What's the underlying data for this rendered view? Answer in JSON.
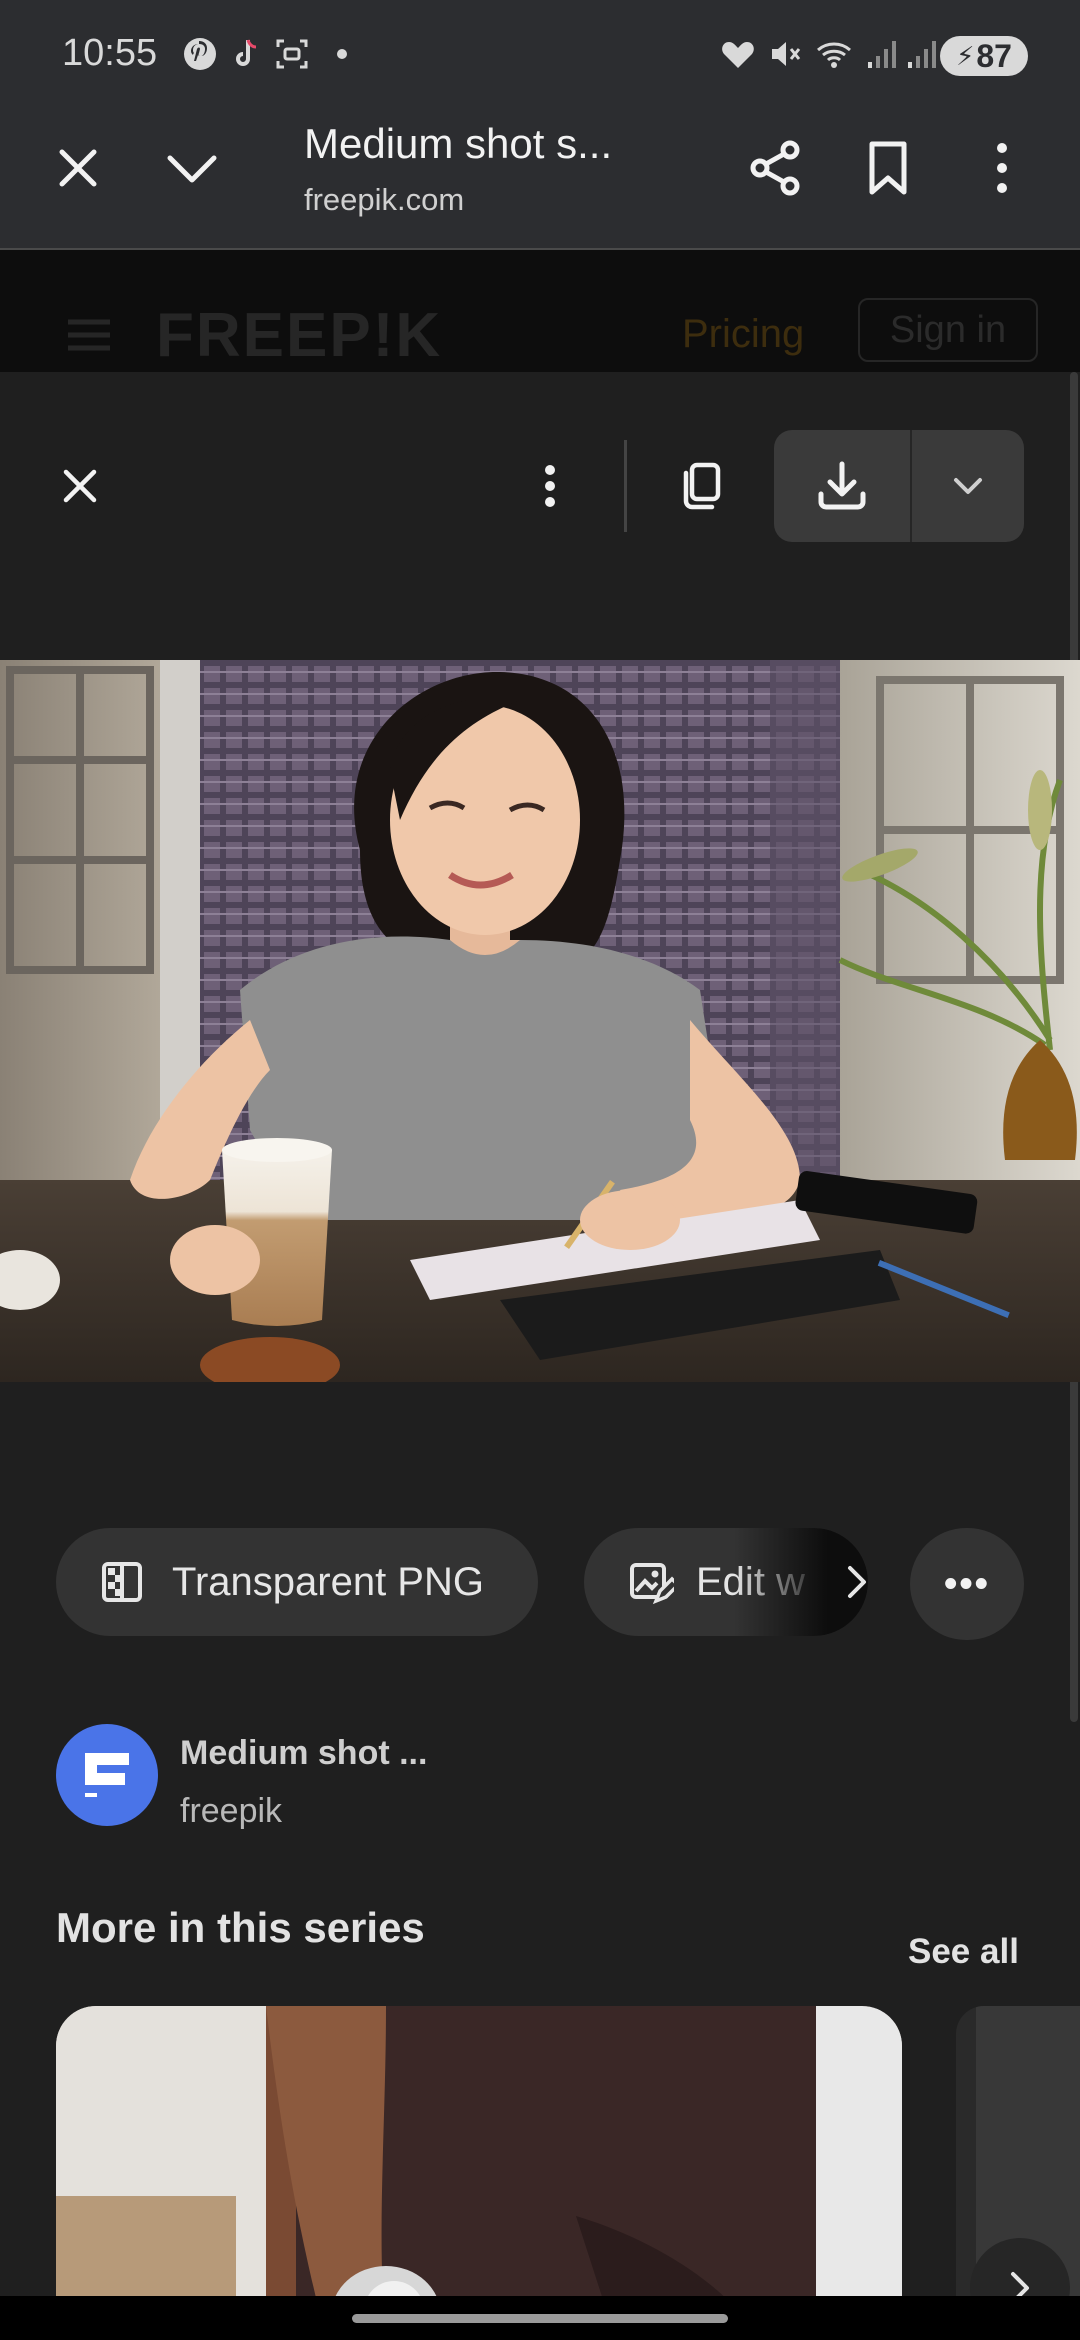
{
  "status_bar": {
    "time": "10:55",
    "battery": "87",
    "left_icons": [
      "pinterest-icon",
      "tiktok-icon",
      "screenshot-icon",
      "dot-icon"
    ],
    "right_icons": [
      "heart-icon",
      "mute-icon",
      "wifi-icon",
      "signal-icon",
      "signal-icon"
    ]
  },
  "custom_tab": {
    "title": "Medium shot s...",
    "url": "freepik.com",
    "icons": [
      "close-icon",
      "chevron-down-icon",
      "share-icon",
      "bookmark-icon",
      "more-vert-icon"
    ]
  },
  "site_header": {
    "logo": "FREEP!K",
    "pricing": "Pricing",
    "signin": "Sign in",
    "accent": "#3d2d0e"
  },
  "viewer": {
    "icons": [
      "close-icon",
      "more-vert-icon",
      "copy-icon",
      "download-icon",
      "chevron-down-icon"
    ],
    "chips": [
      {
        "label": "Transparent PNG",
        "icon": "transparent-png-icon"
      },
      {
        "label": "Edit w",
        "icon": "edit-image-icon"
      }
    ],
    "more_label": "•••"
  },
  "attribution": {
    "title": "Medium shot ...",
    "author": "freepik",
    "avatar_color": "#4a74e8"
  },
  "series": {
    "title": "More in this series",
    "see_all": "See all"
  }
}
